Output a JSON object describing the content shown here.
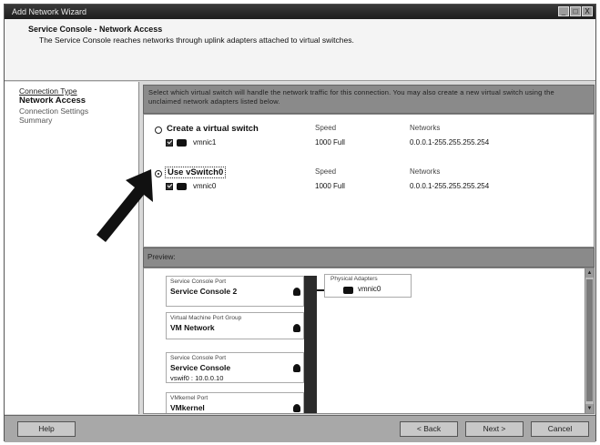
{
  "window": {
    "title": "Add Network Wizard",
    "buttons": [
      "_",
      "□",
      "X"
    ]
  },
  "header": {
    "title": "Service Console - Network Access",
    "subtitle": "The Service Console reaches networks through uplink adapters attached to virtual switches."
  },
  "nav": {
    "items": [
      {
        "label": "Connection Type",
        "state": "link"
      },
      {
        "label": "Network Access",
        "state": "active"
      },
      {
        "label": "Connection Settings",
        "state": "pending"
      },
      {
        "label": "Summary",
        "state": "pending"
      }
    ]
  },
  "instruction": "Select which virtual switch will handle the network traffic for this connection. You may also create a new virtual switch using the unclaimed network adapters listed below.",
  "options": [
    {
      "label": "Create a virtual switch",
      "selected": false,
      "speed_header": "Speed",
      "networks_header": "Networks",
      "nics": [
        {
          "name": "vmnic1",
          "speed": "1000 Full",
          "networks": "0.0.0.1-255.255.255.254",
          "checked": true
        }
      ]
    },
    {
      "label": "Use vSwitch0",
      "selected": true,
      "speed_header": "Speed",
      "networks_header": "Networks",
      "nics": [
        {
          "name": "vmnic0",
          "speed": "1000 Full",
          "networks": "0.0.0.1-255.255.255.254",
          "checked": true
        }
      ]
    }
  ],
  "preview": {
    "header": "Preview:",
    "port_groups": [
      {
        "type": "Service Console Port",
        "name": "Service Console 2",
        "ip": ""
      },
      {
        "type": "Virtual Machine Port Group",
        "name": "VM Network",
        "ip": ""
      },
      {
        "type": "Service Console Port",
        "name": "Service Console",
        "ip": "vswif0 : 10.0.0.10"
      },
      {
        "type": "VMkernel Port",
        "name": "VMkernel",
        "ip": ""
      }
    ],
    "physical_adapters": {
      "title": "Physical Adapters",
      "nic": "vmnic0"
    }
  },
  "footer": {
    "help": "Help",
    "back": "< Back",
    "next": "Next >",
    "cancel": "Cancel"
  },
  "colors": {
    "titlebar": "#1d1d1d",
    "panel_header": "#8a8a8a",
    "footer": "#a8a8a8"
  }
}
